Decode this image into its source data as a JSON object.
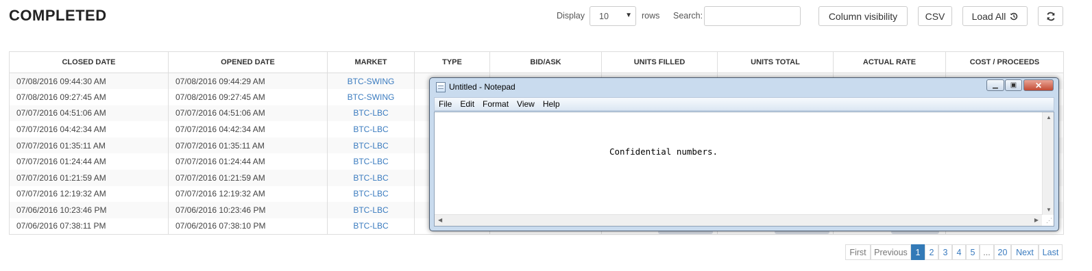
{
  "header": {
    "title": "COMPLETED"
  },
  "controls": {
    "display_label": "Display",
    "rows_value": "10",
    "rows_label": "rows",
    "search_label": "Search:",
    "search_value": "",
    "column_visibility_label": "Column visibility",
    "csv_label": "CSV",
    "load_all_label": "Load All",
    "load_all_icon": "history-icon",
    "refresh_icon": "refresh-icon"
  },
  "table": {
    "columns": [
      "CLOSED DATE",
      "OPENED DATE",
      "MARKET",
      "TYPE",
      "BID/ASK",
      "UNITS FILLED",
      "UNITS TOTAL",
      "ACTUAL RATE",
      "COST / PROCEEDS"
    ],
    "rows": [
      {
        "closed": "07/08/2016 09:44:30 AM",
        "opened": "07/08/2016 09:44:29 AM",
        "market": "BTC-SWING"
      },
      {
        "closed": "07/08/2016 09:27:45 AM",
        "opened": "07/08/2016 09:27:45 AM",
        "market": "BTC-SWING"
      },
      {
        "closed": "07/07/2016 04:51:06 AM",
        "opened": "07/07/2016 04:51:06 AM",
        "market": "BTC-LBC"
      },
      {
        "closed": "07/07/2016 04:42:34 AM",
        "opened": "07/07/2016 04:42:34 AM",
        "market": "BTC-LBC"
      },
      {
        "closed": "07/07/2016 01:35:11 AM",
        "opened": "07/07/2016 01:35:11 AM",
        "market": "BTC-LBC"
      },
      {
        "closed": "07/07/2016 01:24:44 AM",
        "opened": "07/07/2016 01:24:44 AM",
        "market": "BTC-LBC"
      },
      {
        "closed": "07/07/2016 01:21:59 AM",
        "opened": "07/07/2016 01:21:59 AM",
        "market": "BTC-LBC"
      },
      {
        "closed": "07/07/2016 12:19:32 AM",
        "opened": "07/07/2016 12:19:32 AM",
        "market": "BTC-LBC"
      },
      {
        "closed": "07/06/2016 10:23:46 PM",
        "opened": "07/06/2016 10:23:46 PM",
        "market": "BTC-LBC"
      },
      {
        "closed": "07/06/2016 07:38:11 PM",
        "opened": "07/06/2016 07:38:10 PM",
        "market": "BTC-LBC"
      }
    ]
  },
  "pagination": {
    "first": "First",
    "previous": "Previous",
    "pages": [
      "1",
      "2",
      "3",
      "4",
      "5",
      "...",
      "20"
    ],
    "active_page": "1",
    "next": "Next",
    "last": "Last"
  },
  "notepad": {
    "title": "Untitled - Notepad",
    "menu": [
      "File",
      "Edit",
      "Format",
      "View",
      "Help"
    ],
    "content": "Confidential numbers.",
    "icon": "notepad-icon"
  },
  "colors": {
    "link": "#3a7bbf",
    "active_page": "#337ab7",
    "stripe": "#f9f9f9",
    "border": "#dddddd"
  }
}
